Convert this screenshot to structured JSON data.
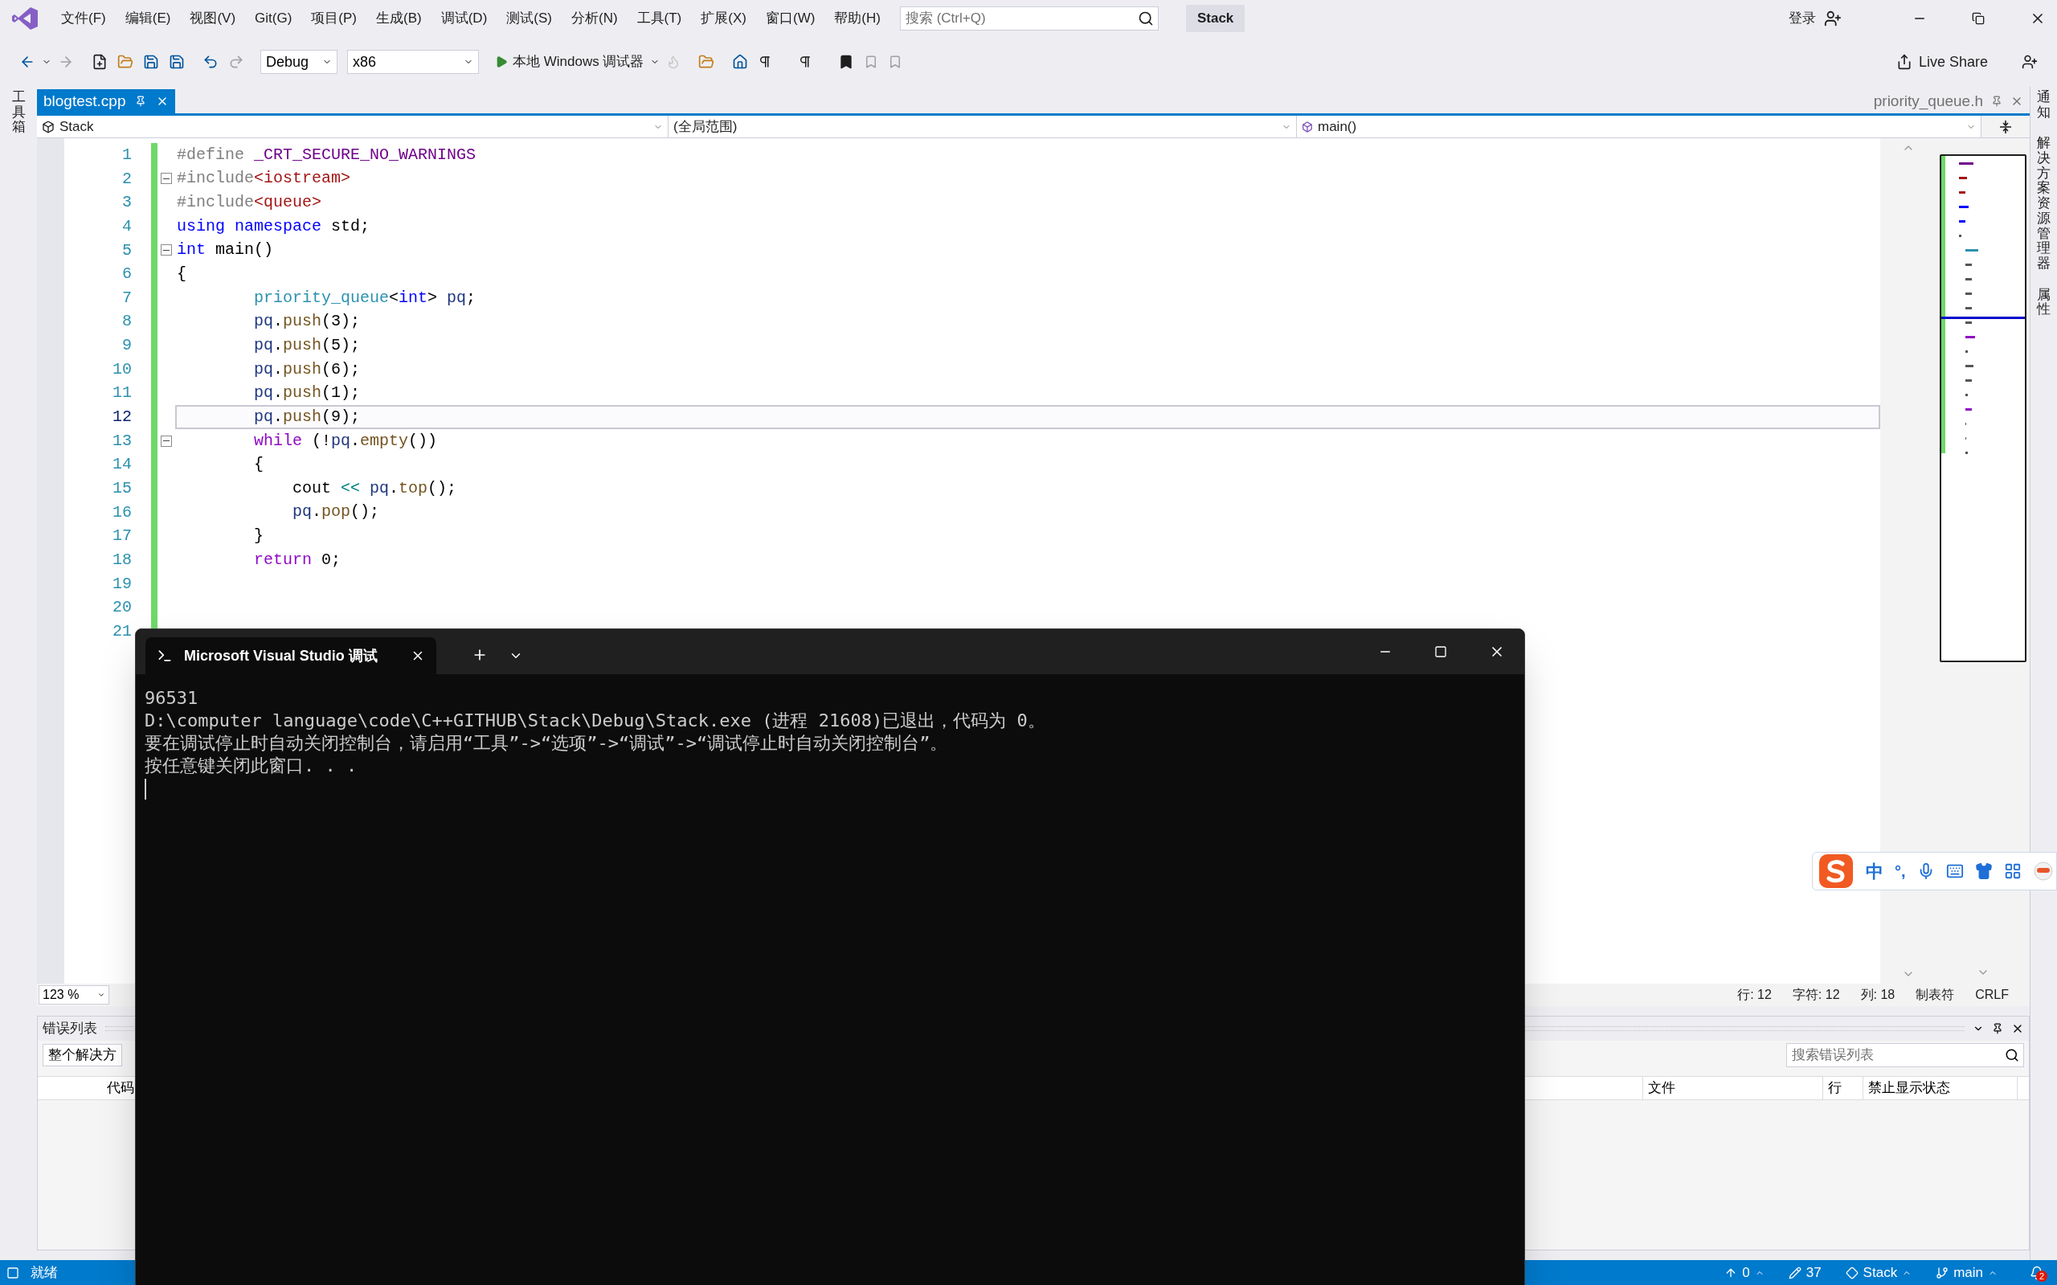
{
  "menu": [
    "文件(F)",
    "编辑(E)",
    "视图(V)",
    "Git(G)",
    "项目(P)",
    "生成(B)",
    "调试(D)",
    "测试(S)",
    "分析(N)",
    "工具(T)",
    "扩展(X)",
    "窗口(W)",
    "帮助(H)"
  ],
  "search": {
    "placeholder": "搜索 (Ctrl+Q)"
  },
  "solution_name": "Stack",
  "account": "登录",
  "toolbar": {
    "configuration": "Debug",
    "platform": "x86",
    "run_label": "本地 Windows 调试器",
    "live_share": "Live Share"
  },
  "left_rail": "工具箱",
  "right_rail": [
    "通知",
    "解决方案资源管理器",
    "属性"
  ],
  "tabs": [
    {
      "label": "blogtest.cpp",
      "selected": true
    },
    {
      "label": "priority_queue.h",
      "selected": false
    }
  ],
  "nav": [
    "Stack",
    "(全局范围)",
    "main()"
  ],
  "code": [
    {
      "number": "1",
      "fold": false,
      "current": false,
      "tokens": [
        {
          "kind": "preproc",
          "text": "#define "
        },
        {
          "kind": "macro",
          "text": "_CRT_SECURE_NO_WARNINGS"
        }
      ]
    },
    {
      "number": "2",
      "fold": true,
      "current": false,
      "tokens": [
        {
          "kind": "preproc",
          "text": "#include"
        },
        {
          "kind": "string",
          "text": "<iostream>"
        }
      ]
    },
    {
      "number": "3",
      "fold": false,
      "current": false,
      "tokens": [
        {
          "kind": "preproc",
          "text": "#include"
        },
        {
          "kind": "string",
          "text": "<queue>"
        }
      ]
    },
    {
      "number": "4",
      "fold": false,
      "current": false,
      "tokens": [
        {
          "kind": "keyword",
          "text": "using namespace"
        },
        {
          "kind": "plain",
          "text": " std;"
        }
      ]
    },
    {
      "number": "5",
      "fold": true,
      "current": false,
      "tokens": [
        {
          "kind": "keyword",
          "text": "int"
        },
        {
          "kind": "plain",
          "text": " main()"
        }
      ]
    },
    {
      "number": "6",
      "fold": false,
      "current": false,
      "tokens": [
        {
          "kind": "plain",
          "text": "{"
        }
      ]
    },
    {
      "number": "7",
      "fold": false,
      "current": false,
      "tokens": [
        {
          "kind": "type",
          "text": "        priority_queue"
        },
        {
          "kind": "plain",
          "text": "<"
        },
        {
          "kind": "keyword",
          "text": "int"
        },
        {
          "kind": "plain",
          "text": "> "
        },
        {
          "kind": "variable",
          "text": "pq"
        },
        {
          "kind": "plain",
          "text": ";"
        }
      ]
    },
    {
      "number": "8",
      "fold": false,
      "current": false,
      "tokens": [
        {
          "kind": "variable",
          "text": "        pq"
        },
        {
          "kind": "plain",
          "text": "."
        },
        {
          "kind": "function",
          "text": "push"
        },
        {
          "kind": "plain",
          "text": "(3);"
        }
      ]
    },
    {
      "number": "9",
      "fold": false,
      "current": false,
      "tokens": [
        {
          "kind": "variable",
          "text": "        pq"
        },
        {
          "kind": "plain",
          "text": "."
        },
        {
          "kind": "function",
          "text": "push"
        },
        {
          "kind": "plain",
          "text": "(5);"
        }
      ]
    },
    {
      "number": "10",
      "fold": false,
      "current": false,
      "tokens": [
        {
          "kind": "variable",
          "text": "        pq"
        },
        {
          "kind": "plain",
          "text": "."
        },
        {
          "kind": "function",
          "text": "push"
        },
        {
          "kind": "plain",
          "text": "(6);"
        }
      ]
    },
    {
      "number": "11",
      "fold": false,
      "current": false,
      "tokens": [
        {
          "kind": "variable",
          "text": "        pq"
        },
        {
          "kind": "plain",
          "text": "."
        },
        {
          "kind": "function",
          "text": "push"
        },
        {
          "kind": "plain",
          "text": "(1);"
        }
      ]
    },
    {
      "number": "12",
      "fold": false,
      "current": true,
      "tokens": [
        {
          "kind": "variable",
          "text": "        pq"
        },
        {
          "kind": "plain",
          "text": "."
        },
        {
          "kind": "function",
          "text": "push"
        },
        {
          "kind": "plain",
          "text": "(9);"
        }
      ]
    },
    {
      "number": "13",
      "fold": true,
      "current": false,
      "tokens": [
        {
          "kind": "control",
          "text": "        while"
        },
        {
          "kind": "plain",
          "text": " (!"
        },
        {
          "kind": "variable",
          "text": "pq"
        },
        {
          "kind": "plain",
          "text": "."
        },
        {
          "kind": "function",
          "text": "empty"
        },
        {
          "kind": "plain",
          "text": "())"
        }
      ]
    },
    {
      "number": "14",
      "fold": false,
      "current": false,
      "tokens": [
        {
          "kind": "plain",
          "text": "        {"
        }
      ]
    },
    {
      "number": "15",
      "fold": false,
      "current": false,
      "tokens": [
        {
          "kind": "plain",
          "text": "            cout "
        },
        {
          "kind": "operator",
          "text": "<<"
        },
        {
          "kind": "variable",
          "text": " pq"
        },
        {
          "kind": "plain",
          "text": "."
        },
        {
          "kind": "function",
          "text": "top"
        },
        {
          "kind": "plain",
          "text": "();"
        }
      ]
    },
    {
      "number": "16",
      "fold": false,
      "current": false,
      "tokens": [
        {
          "kind": "variable",
          "text": "            pq"
        },
        {
          "kind": "plain",
          "text": "."
        },
        {
          "kind": "function",
          "text": "pop"
        },
        {
          "kind": "plain",
          "text": "();"
        }
      ]
    },
    {
      "number": "17",
      "fold": false,
      "current": false,
      "tokens": [
        {
          "kind": "plain",
          "text": "        }"
        }
      ]
    },
    {
      "number": "18",
      "fold": false,
      "current": false,
      "tokens": [
        {
          "kind": "control",
          "text": "        return"
        },
        {
          "kind": "plain",
          "text": " 0;"
        }
      ]
    },
    {
      "number": "19",
      "fold": false,
      "current": false
    },
    {
      "number": "20",
      "fold": false,
      "current": false
    },
    {
      "number": "21",
      "fold": false,
      "current": false
    }
  ],
  "zoom": "123 %",
  "cursor_info": [
    "行: 12",
    "字符: 12",
    "列: 18",
    "制表符",
    "CRLF"
  ],
  "error_list": {
    "title": "错误列表",
    "scope": "整个解决方",
    "search_placeholder": "搜索错误列表",
    "columns": [
      "代码",
      "文件",
      "行",
      "禁止显示状态"
    ]
  },
  "console": {
    "title": "Microsoft Visual Studio 调试",
    "lines": [
      "96531",
      "D:\\computer language\\code\\C++GITHUB\\Stack\\Debug\\Stack.exe (进程 21608)已退出，代码为 0。",
      "要在调试停止时自动关闭控制台，请启用“工具”->“选项”->“调试”->“调试停止时自动关闭控制台”。",
      "按任意键关闭此窗口. . ."
    ]
  },
  "ime": {
    "mode": "中",
    "punctuation": "°,"
  },
  "status_bar": {
    "state": "就绪",
    "pushes": "0",
    "changes": "37",
    "repository": "Stack",
    "branch": "main",
    "notifications": "2"
  }
}
